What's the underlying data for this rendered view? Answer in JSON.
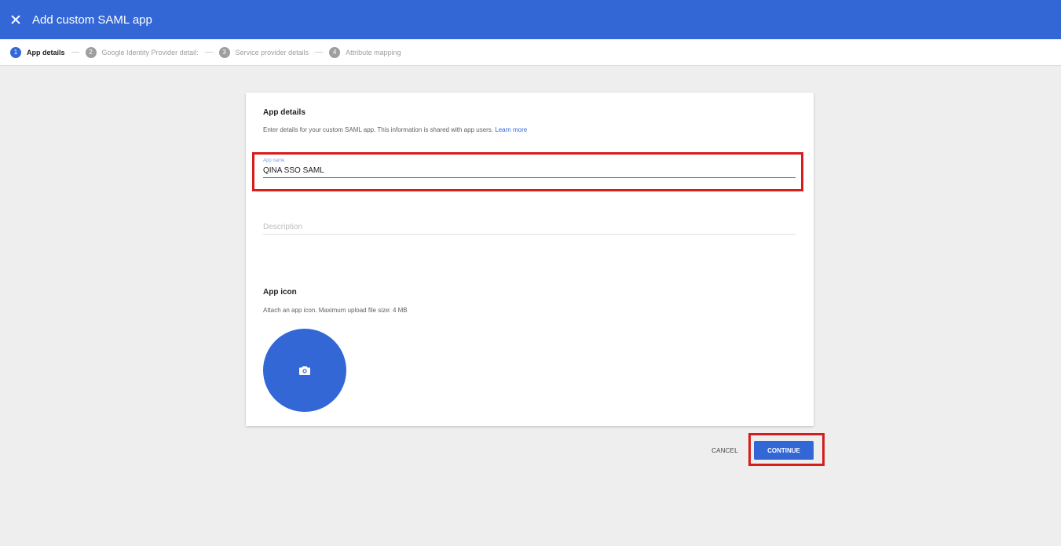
{
  "header": {
    "title": "Add custom SAML app",
    "close_icon": "close-icon"
  },
  "stepper": [
    {
      "num": "1",
      "label": "App details"
    },
    {
      "num": "2",
      "label": "Google Identity Provider detail:"
    },
    {
      "num": "3",
      "label": "Service provider details"
    },
    {
      "num": "4",
      "label": "Attribute mapping"
    }
  ],
  "app_details": {
    "title": "App details",
    "description": "Enter details for your custom SAML app. This information is shared with app users.",
    "learn_more": "Learn more",
    "app_name": {
      "label": "App name",
      "value": "QINA SSO SAML"
    },
    "description_field": {
      "placeholder": "Description"
    }
  },
  "app_icon": {
    "title": "App icon",
    "description": "Attach an app icon. Maximum upload file size: 4 MB",
    "icon": "camera-icon"
  },
  "actions": {
    "cancel": "CANCEL",
    "continue": "CONTINUE"
  },
  "colors": {
    "primary": "#3367d6",
    "highlight": "#d81b1b"
  }
}
